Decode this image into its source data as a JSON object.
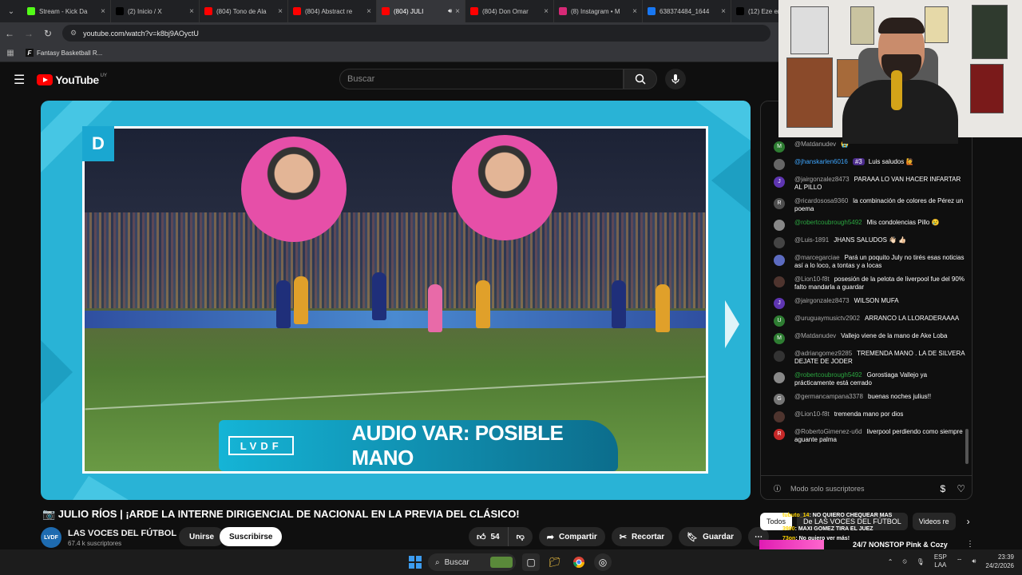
{
  "browser": {
    "tabs": [
      {
        "title": "Stream - Kick Da",
        "icon": "kick-icon",
        "color": "#53fc18"
      },
      {
        "title": "(2) Inicio / X",
        "icon": "x-icon",
        "color": "#000000"
      },
      {
        "title": "(804) Tono de Ala",
        "icon": "youtube-icon",
        "color": "#ff0000"
      },
      {
        "title": "(804) Abstract re",
        "icon": "youtube-icon",
        "color": "#ff0000"
      },
      {
        "title": "(804) JULI",
        "icon": "youtube-icon",
        "color": "#ff0000",
        "active": true
      },
      {
        "title": "(804) Don Omar",
        "icon": "youtube-icon",
        "color": "#ff0000"
      },
      {
        "title": "(8) Instagram • M",
        "icon": "instagram-icon",
        "color": "#d62976"
      },
      {
        "title": "638374484_1644",
        "icon": "facebook-icon",
        "color": "#1877f2"
      },
      {
        "title": "(12) Eze en",
        "icon": "x-icon",
        "color": "#000000"
      }
    ],
    "url": "youtube.com/watch?v=k8bj9AOyctU",
    "bookmark": "Fantasy Basketball R..."
  },
  "youtube": {
    "logo_text": "YouTube",
    "country_code": "UY",
    "search_placeholder": "Buscar"
  },
  "video": {
    "overlay_letter": "D",
    "lower_third_logo": "LVDF",
    "lower_third_text": "AUDIO VAR: POSIBLE MANO",
    "title": "📷 JULIO RÍOS | ¡ARDE LA INTERNE DIRIGENCIAL DE NACIONAL EN LA PREVIA DEL CLÁSICO!",
    "channel_name": "LAS VOCES DEL FÚTBOL",
    "channel_avatar_text": "LVDF",
    "subscribers": "67.4 k suscriptores",
    "join_label": "Unirse",
    "subscribe_label": "Suscribirse",
    "likes": "54",
    "share_label": "Compartir",
    "clip_label": "Recortar",
    "save_label": "Guardar"
  },
  "chat": {
    "messages": [
      {
        "author": "@Matdanudev",
        "text": "😭",
        "avatar": "M",
        "color": "#2e7d32",
        "style": ""
      },
      {
        "author": "@jhanskarlen6016",
        "badge": "#3",
        "text": "Luis saludos 🙋",
        "avatar": "",
        "color": "#666666",
        "style": "blue"
      },
      {
        "author": "@jairgonzalez8473",
        "text": "PARAAA LO VAN HACER INFARTAR AL PILLO",
        "avatar": "J",
        "color": "#5e35b1",
        "style": ""
      },
      {
        "author": "@ricardososa9360",
        "text": "la combinación de colores de Pérez un poema",
        "avatar": "R",
        "color": "#4e4e4e",
        "style": ""
      },
      {
        "author": "@robertcoubrough5492",
        "text": "Mis condolencias Pillo 😢",
        "avatar": "",
        "color": "#888888",
        "style": "member"
      },
      {
        "author": "@Luis-1891",
        "text": "JHANS SALUDOS 👋🏻 👍🏻",
        "avatar": "",
        "color": "#444444",
        "style": ""
      },
      {
        "author": "@marcegarciae",
        "text": "Pará un poquito July no tirés esas noticias así a lo loco, a tontas y a locas",
        "avatar": "",
        "color": "#5c6bc0",
        "style": ""
      },
      {
        "author": "@Lion10-f8t",
        "text": "posesión de la pelota de liverpool fue del 90% falto mandarla a guardar",
        "avatar": "",
        "color": "#4e342e",
        "style": ""
      },
      {
        "author": "@jairgonzalez8473",
        "text": "WILSON MUFA",
        "avatar": "J",
        "color": "#5e35b1",
        "style": ""
      },
      {
        "author": "@uruguaymusictv2902",
        "text": "ARRANCO LA LLORADERAAAA",
        "avatar": "U",
        "color": "#2e7d32",
        "style": ""
      },
      {
        "author": "@Matdanudev",
        "text": "Vallejo viene de la mano de Ake Loba",
        "avatar": "M",
        "color": "#2e7d32",
        "style": ""
      },
      {
        "author": "@adriangomez9285",
        "text": "TREMENDA MANO . LA DE SILVERA DEJATE DE JODER",
        "avatar": "",
        "color": "#333333",
        "style": ""
      },
      {
        "author": "@robertcoubrough5492",
        "text": "Gorostiaga Vallejo ya prácticamente está cerrado",
        "avatar": "",
        "color": "#888888",
        "style": "member"
      },
      {
        "author": "@germancampana3378",
        "text": "buenas noches julius!!",
        "avatar": "G",
        "color": "#757575",
        "style": ""
      },
      {
        "author": "@Lion10-f8t",
        "text": "tremenda mano por dios",
        "avatar": "",
        "color": "#4e342e",
        "style": ""
      },
      {
        "author": "@RobertoGimenez-u6d",
        "text": "liverpool perdiendo como siempre aguante palma",
        "avatar": "R",
        "color": "#c62828",
        "style": ""
      }
    ],
    "footer_text": "Modo solo suscriptores",
    "chip_all": "Todos",
    "chip_channel": "De LAS VOCES DEL FÚTBOL",
    "chip_videos": "Videos re"
  },
  "overlay": {
    "ticker_1_user": "tubuto_14",
    "ticker_1_text": ": NO QUIERO CHEQUEAR MAS",
    "ticker_2_user": "3990",
    "ticker_2_text": ": MAXI GOMEZ TIRA EL JUEZ",
    "ticker_3_user": "73on",
    "ticker_3_text": ": No quiero ver más!",
    "promo_text": "24/7 NONSTOP Pink & Cozy"
  },
  "taskbar": {
    "search_label": "Buscar",
    "lang_1": "ESP",
    "lang_2": "LAA",
    "time": "23:39",
    "date": "24/2/2026"
  }
}
